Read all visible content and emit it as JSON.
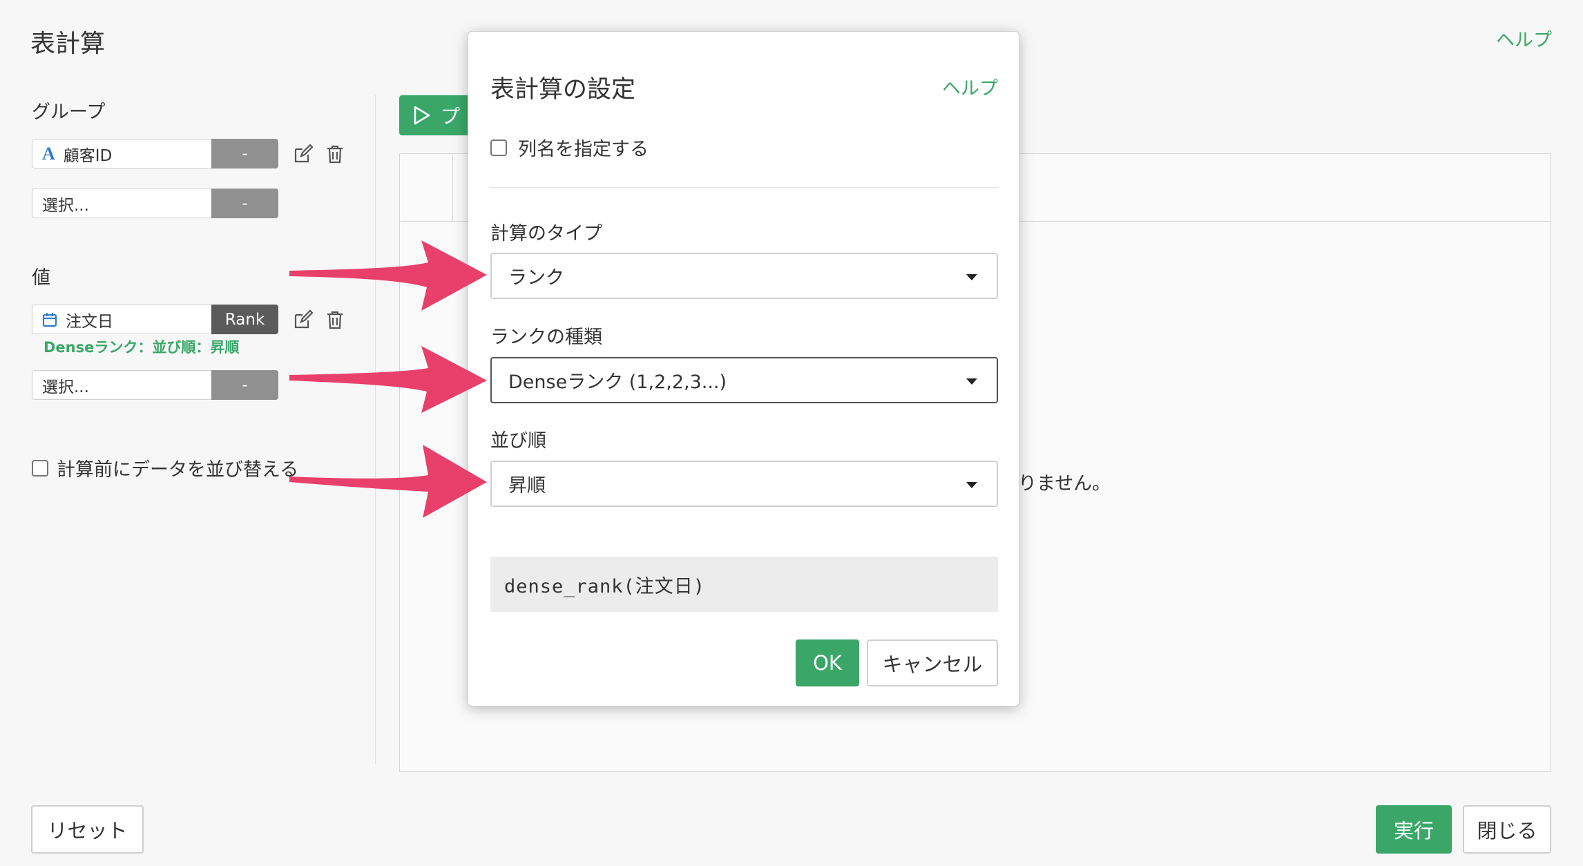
{
  "page": {
    "title": "表計算",
    "help": "ヘルプ"
  },
  "group": {
    "label": "グループ",
    "fields": [
      {
        "name": "顧客ID",
        "side": "-"
      },
      {
        "name": "選択...",
        "side": "-"
      }
    ]
  },
  "value": {
    "label": "値",
    "fields": [
      {
        "name": "注文日",
        "side": "Rank"
      },
      {
        "name": "選択...",
        "side": "-"
      }
    ],
    "hint": "Denseランク：並び順：昇順"
  },
  "pre_sort": {
    "label": "計算前にデータを並び替える",
    "checked": false
  },
  "preview": {
    "button": "プ",
    "message_fragment": "りません。"
  },
  "footer": {
    "reset": "リセット",
    "run": "実行",
    "close": "閉じる"
  },
  "modal": {
    "title": "表計算の設定",
    "help": "ヘルプ",
    "specify_colname": "列名を指定する",
    "calc_type_label": "計算のタイプ",
    "calc_type_value": "ランク",
    "rank_kind_label": "ランクの種類",
    "rank_kind_value": "Denseランク (1,2,2,3...)",
    "sort_label": "並び順",
    "sort_value": "昇順",
    "formula": "dense_rank(注文日)",
    "ok": "OK",
    "cancel": "キャンセル"
  },
  "colors": {
    "accent": "#3aa769",
    "arrow": "#e8406b",
    "type_icon_blue": "#2f7cc9"
  }
}
